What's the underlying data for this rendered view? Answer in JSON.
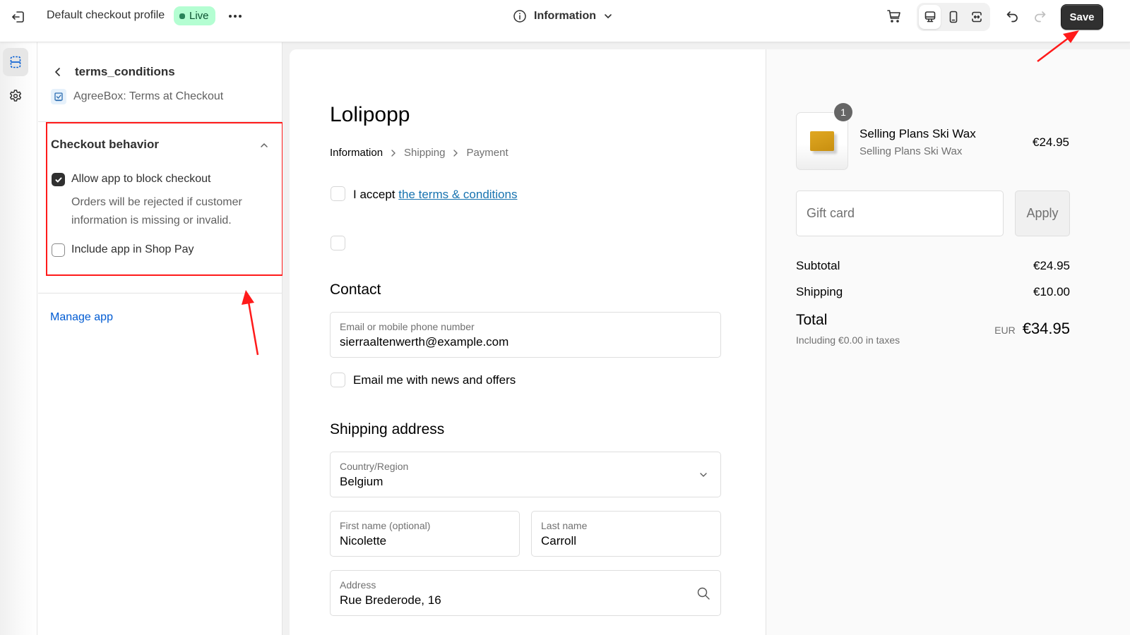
{
  "topbar": {
    "exit_icon": "exit-icon",
    "title": "Default checkout profile",
    "status_badge": "Live",
    "more_icon": "ellipsis-icon",
    "page_selector": {
      "icon": "info-circle-icon",
      "label": "Information"
    },
    "preview_icons": [
      "cart-icon",
      "desktop-icon",
      "mobile-icon",
      "fullscreen-icon"
    ],
    "active_device": "desktop",
    "undo_icon": "undo-icon",
    "redo_icon": "redo-icon",
    "save_label": "Save"
  },
  "rail": {
    "items": [
      {
        "icon": "sections-icon",
        "active": true
      },
      {
        "icon": "gear-icon",
        "active": false
      }
    ]
  },
  "sidebar": {
    "title": "terms_conditions",
    "app_name": "AgreeBox: Terms at Checkout",
    "section": {
      "title": "Checkout behavior",
      "expanded": true,
      "options": [
        {
          "label": "Allow app to block checkout",
          "checked": true,
          "help": "Orders will be rejected if customer information is missing or invalid."
        },
        {
          "label": "Include app in Shop Pay",
          "checked": false
        }
      ]
    },
    "manage_link": "Manage app"
  },
  "checkout": {
    "shop_name": "Lolipopp",
    "breadcrumbs": [
      {
        "label": "Information",
        "current": true
      },
      {
        "label": "Shipping",
        "current": false
      },
      {
        "label": "Payment",
        "current": false
      }
    ],
    "terms": {
      "prefix": "I accept ",
      "link": "the terms & conditions",
      "checked": false
    },
    "empty_checkbox_checked": false,
    "contact": {
      "heading": "Contact",
      "email_label": "Email or mobile phone number",
      "email_value": "sierraaltenwerth@example.com",
      "newsletter_label": "Email me with news and offers",
      "newsletter_checked": false
    },
    "shipping": {
      "heading": "Shipping address",
      "country_label": "Country/Region",
      "country_value": "Belgium",
      "first_name_label": "First name (optional)",
      "first_name_value": "Nicolette",
      "last_name_label": "Last name",
      "last_name_value": "Carroll",
      "address_label": "Address",
      "address_value": "Rue Brederode, 16"
    }
  },
  "summary": {
    "item": {
      "quantity": "1",
      "name": "Selling Plans Ski Wax",
      "variant": "Selling Plans Ski Wax",
      "price": "€24.95"
    },
    "gift_card_placeholder": "Gift card",
    "apply_label": "Apply",
    "subtotal_label": "Subtotal",
    "subtotal_value": "€24.95",
    "shipping_label": "Shipping",
    "shipping_value": "€10.00",
    "total_label": "Total",
    "tax_note": "Including €0.00 in taxes",
    "currency_code": "EUR",
    "total_value": "€34.95"
  },
  "colors": {
    "annotation_red": "#ff1a1a",
    "live_badge_bg": "#b4fed2",
    "link_blue": "#005bd3",
    "checkout_link": "#1773b0",
    "save_button": "#303030"
  }
}
